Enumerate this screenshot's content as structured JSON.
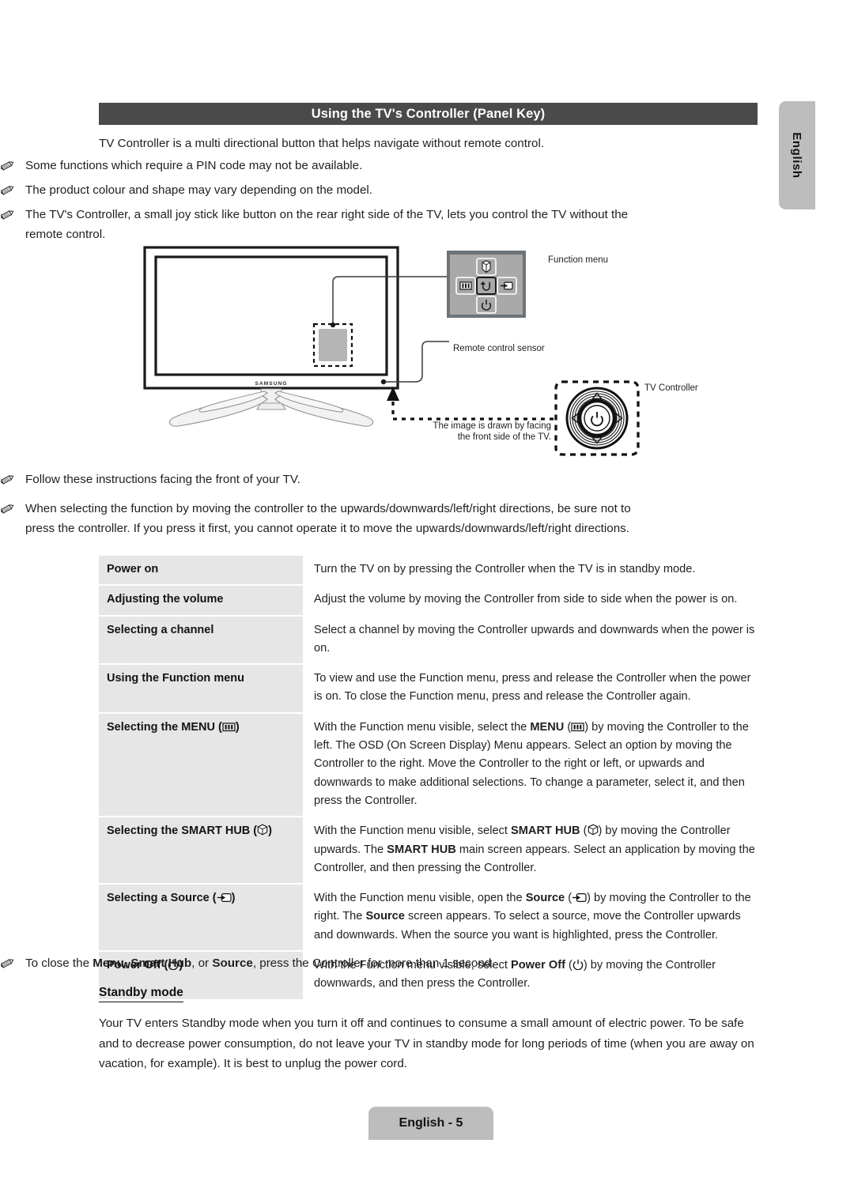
{
  "side_tab": {
    "label": "English"
  },
  "header": {
    "title": "Using the TV's Controller (Panel Key)"
  },
  "intro": "TV Controller is a multi directional button that helps navigate without remote control.",
  "notes_top": [
    "Some functions which require a PIN code may not be available.",
    "The product colour and shape may vary depending on the model.",
    "The TV's Controller, a small joy stick like button on the rear right side of the TV, lets you control the TV without the remote control."
  ],
  "figure": {
    "tv_brand": "SAMSUNG",
    "labels": {
      "function_menu": "Function menu",
      "remote_sensor": "Remote control sensor",
      "tv_controller": "TV Controller"
    },
    "caption_line1": "The image is drawn by facing",
    "caption_line2": "the front side of the TV.",
    "function_menu_icons": [
      "smart-hub-icon",
      "menu-icon",
      "return-icon",
      "source-icon",
      "power-icon"
    ]
  },
  "notes_mid": [
    "Follow these instructions facing the front of your TV.",
    "When selecting the function by moving the controller to the upwards/downwards/left/right directions, be sure not to press the controller. If you press it first, you cannot operate it to move the upwards/downwards/left/right directions."
  ],
  "table": {
    "rows": [
      {
        "label_plain": "Power on",
        "label_parts": [
          {
            "t": "Power on",
            "b": true
          }
        ],
        "desc_parts": [
          {
            "t": "Turn the TV on by pressing the Controller when the TV is in standby mode."
          }
        ]
      },
      {
        "label_plain": "Adjusting the volume",
        "label_parts": [
          {
            "t": "Adjusting the volume",
            "b": true
          }
        ],
        "desc_parts": [
          {
            "t": "Adjust the volume by moving the Controller from side to side when the power is on."
          }
        ]
      },
      {
        "label_plain": "Selecting a channel",
        "label_parts": [
          {
            "t": "Selecting a channel",
            "b": true
          }
        ],
        "desc_parts": [
          {
            "t": "Select a channel by moving the Controller upwards and downwards when the power is on."
          }
        ]
      },
      {
        "label_plain": "Using the Function menu",
        "label_parts": [
          {
            "t": "Using the Function menu",
            "b": true
          }
        ],
        "desc_parts": [
          {
            "t": "To view and use the Function menu, press and release the Controller when the power is on. To close the Function menu, press and release the Controller again."
          }
        ]
      },
      {
        "label_plain": "Selecting the MENU (menu-icon)",
        "label_parts": [
          {
            "t": "Selecting the MENU (",
            "b": true
          },
          {
            "icon": "menu-icon"
          },
          {
            "t": ")",
            "b": true
          }
        ],
        "desc_parts": [
          {
            "t": "With the Function menu visible, select the "
          },
          {
            "t": "MENU",
            "b": true
          },
          {
            "t": " ("
          },
          {
            "icon": "menu-icon"
          },
          {
            "t": ") by moving the Controller to the left. The OSD (On Screen Display) Menu appears. Select an option by moving the Controller to the right. Move the Controller to the right or left, or upwards and downwards to make additional selections. To change a parameter, select it, and then press the Controller."
          }
        ]
      },
      {
        "label_plain": "Selecting the SMART HUB (smart-hub-icon)",
        "label_parts": [
          {
            "t": "Selecting the SMART HUB (",
            "b": true
          },
          {
            "icon": "smart-hub-icon"
          },
          {
            "t": ")",
            "b": true
          }
        ],
        "desc_parts": [
          {
            "t": "With the Function menu visible, select "
          },
          {
            "t": "SMART HUB",
            "b": true
          },
          {
            "t": " ("
          },
          {
            "icon": "smart-hub-icon"
          },
          {
            "t": ") by moving the Controller upwards. The "
          },
          {
            "t": "SMART HUB",
            "b": true
          },
          {
            "t": " main screen appears. Select an application by moving the Controller, and then pressing the Controller."
          }
        ]
      },
      {
        "label_plain": "Selecting a Source (source-icon)",
        "label_parts": [
          {
            "t": "Selecting a Source (",
            "b": true
          },
          {
            "icon": "source-icon"
          },
          {
            "t": ")",
            "b": true
          }
        ],
        "desc_parts": [
          {
            "t": "With the Function menu visible, open the "
          },
          {
            "t": "Source",
            "b": true
          },
          {
            "t": " ("
          },
          {
            "icon": "source-icon"
          },
          {
            "t": ") by moving the Controller to the right. The "
          },
          {
            "t": "Source",
            "b": true
          },
          {
            "t": " screen appears. To select a source, move the Controller upwards and downwards. When the source you want is highlighted, press the Controller."
          }
        ]
      },
      {
        "label_plain": "Power Off (power-icon)",
        "label_parts": [
          {
            "t": "Power Off (",
            "b": true
          },
          {
            "icon": "power-icon"
          },
          {
            "t": ")",
            "b": true
          }
        ],
        "desc_parts": [
          {
            "t": "With the Function menu visible, select "
          },
          {
            "t": "Power Off",
            "b": true
          },
          {
            "t": " ("
          },
          {
            "icon": "power-icon"
          },
          {
            "t": ") by moving the Controller downwards, and then press the Controller."
          }
        ]
      }
    ]
  },
  "note_bottom_parts": [
    {
      "t": "To close the "
    },
    {
      "t": "Menu",
      "b": true
    },
    {
      "t": ", "
    },
    {
      "t": "Smart Hub",
      "b": true
    },
    {
      "t": ", or "
    },
    {
      "t": "Source",
      "b": true
    },
    {
      "t": ", press the Controller for more than 1 second."
    }
  ],
  "standby": {
    "heading": "Standby mode",
    "body": "Your TV enters Standby mode when you turn it off and continues to consume a small amount of electric power. To be safe and to decrease power consumption, do not leave your TV in standby mode for long periods of time (when you are away on vacation, for example). It is best to unplug the power cord."
  },
  "footer": {
    "page_label": "English - 5"
  },
  "colors": {
    "title_bar": "#4a4a4a",
    "row_label_bg": "#e6e6e6",
    "tab_bg": "#bdbdbd",
    "text": "#1f1f1f"
  }
}
